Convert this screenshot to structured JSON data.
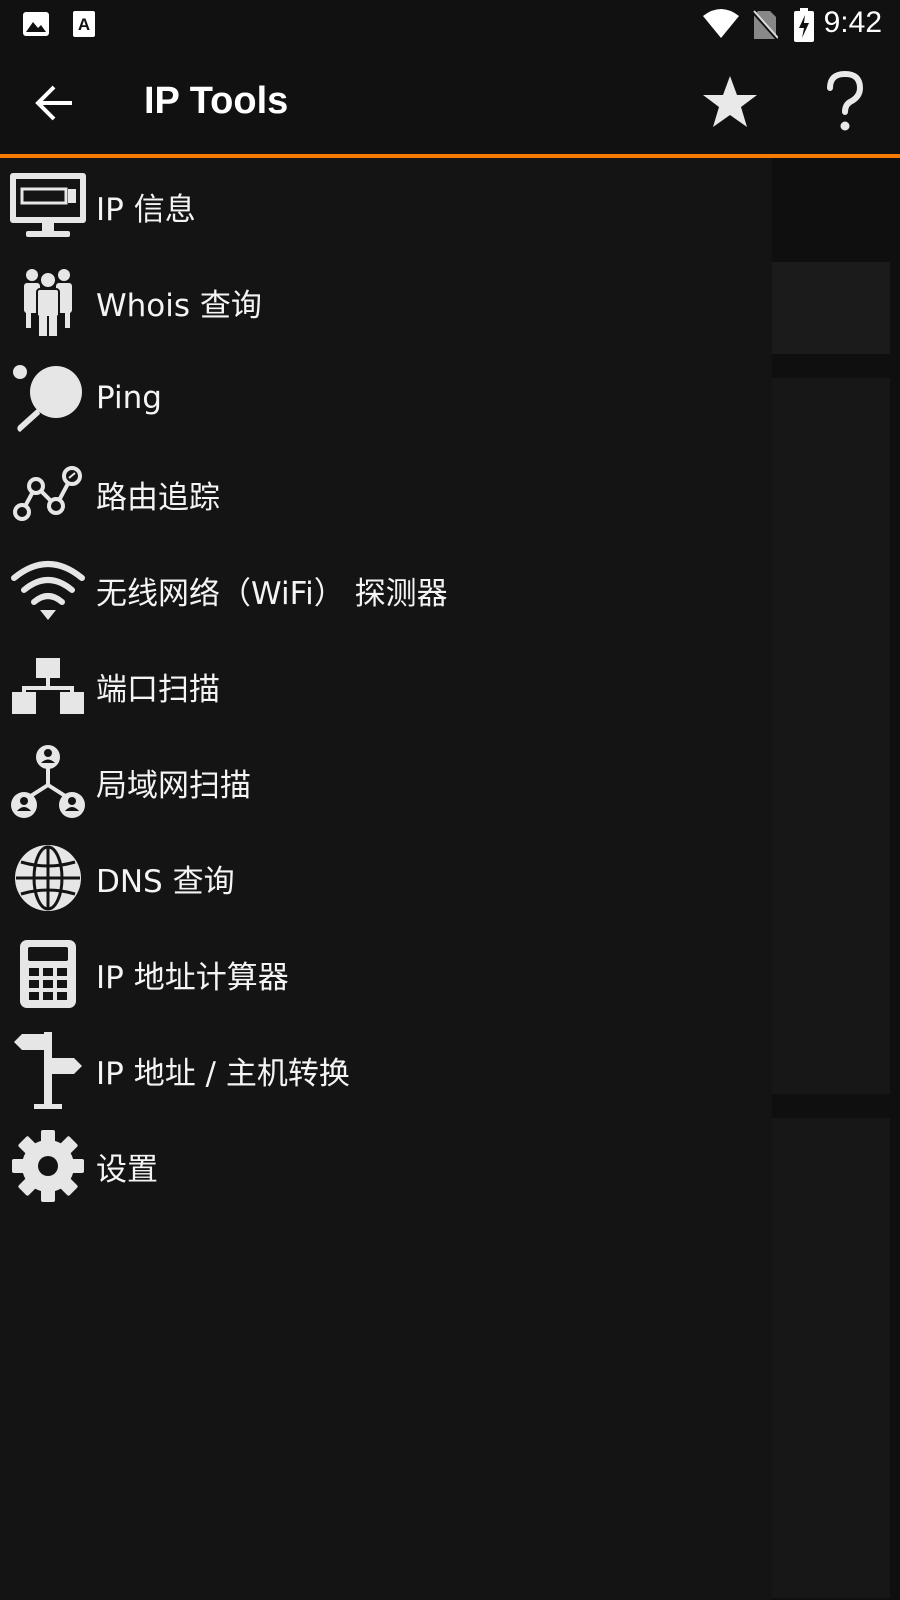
{
  "status_bar": {
    "time": "9:42",
    "icons": [
      "image-icon",
      "font-download-icon",
      "wifi-icon",
      "no-sim-icon",
      "battery-charging-icon"
    ]
  },
  "app_bar": {
    "title": "IP Tools",
    "actions": [
      "back-arrow-icon",
      "star-icon",
      "help-icon"
    ]
  },
  "drawer": {
    "items": [
      {
        "label": "IP 信息",
        "icon": "monitor-icon"
      },
      {
        "label": "Whois 查询",
        "icon": "people-icon"
      },
      {
        "label": "Ping",
        "icon": "ping-pong-icon"
      },
      {
        "label": "路由追踪",
        "icon": "route-nodes-icon"
      },
      {
        "label": "无线网络（WiFi） 探测器",
        "icon": "wifi-icon"
      },
      {
        "label": "端口扫描",
        "icon": "network-blocks-icon"
      },
      {
        "label": "局域网扫描",
        "icon": "lan-users-icon"
      },
      {
        "label": "DNS 查询",
        "icon": "globe-icon"
      },
      {
        "label": "IP 地址计算器",
        "icon": "calculator-icon"
      },
      {
        "label": "IP 地址 / 主机转换",
        "icon": "signpost-icon"
      },
      {
        "label": "设置",
        "icon": "gear-icon"
      }
    ]
  },
  "colors": {
    "background": "#121212",
    "accent": "#f57c00",
    "icon": "#e6e6e6",
    "text": "#f4f4f4"
  }
}
